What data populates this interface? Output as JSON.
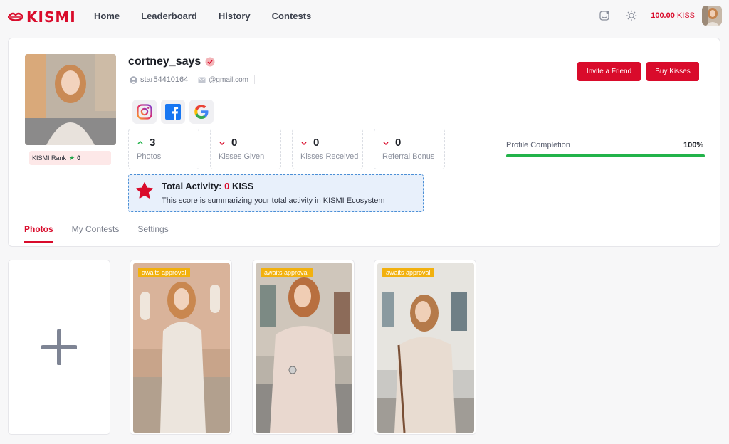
{
  "brand": {
    "name": "KISMI",
    "color": "#d90b2b"
  },
  "nav": {
    "items": [
      "Home",
      "Leaderboard",
      "History",
      "Contests"
    ]
  },
  "header": {
    "balance_value": "100.00",
    "balance_unit": "KISS"
  },
  "profile": {
    "username": "cortney_says",
    "user_id": "star54410164",
    "email": "@gmail.com",
    "rank_label": "KISMI Rank",
    "rank_value": "0",
    "invite_label": "Invite a Friend",
    "buy_label": "Buy Kisses",
    "socials": [
      "instagram-icon",
      "facebook-icon",
      "google-icon"
    ]
  },
  "stats": [
    {
      "value": "3",
      "label": "Photos",
      "trend": "up"
    },
    {
      "value": "0",
      "label": "Kisses Given",
      "trend": "down"
    },
    {
      "value": "0",
      "label": "Kisses Received",
      "trend": "down"
    },
    {
      "value": "0",
      "label": "Referral Bonus",
      "trend": "down"
    }
  ],
  "activity": {
    "title_prefix": "Total Activity:",
    "value": "0",
    "unit": "KISS",
    "description": "This score is summarizing your total activity in KISMI Ecosystem"
  },
  "completion": {
    "label": "Profile Completion",
    "percent_text": "100%",
    "percent": 100
  },
  "tabs": [
    "Photos",
    "My Contests",
    "Settings"
  ],
  "photos": [
    {
      "badge": "awaits approval"
    },
    {
      "badge": "awaits approval"
    },
    {
      "badge": "awaits approval"
    }
  ],
  "colors": {
    "accent": "#d90b2b",
    "success": "#22b34a",
    "badge": "#f2b10e",
    "activity_bg": "#e8f0fb"
  }
}
